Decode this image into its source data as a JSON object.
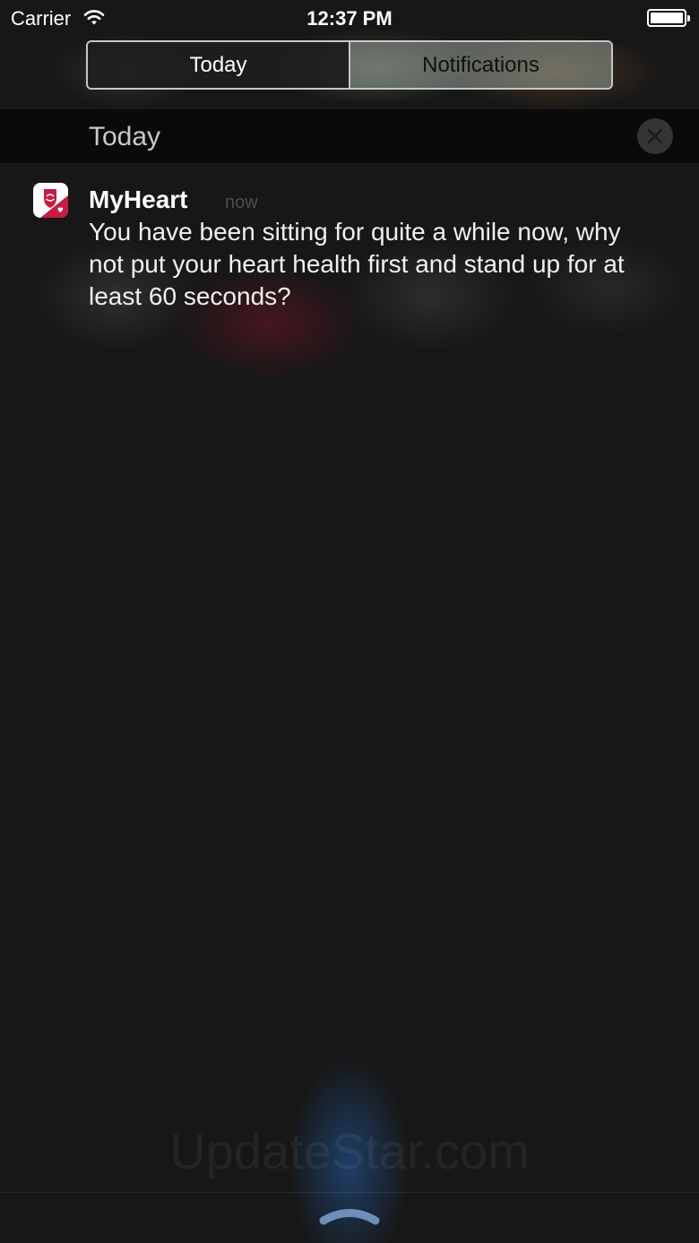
{
  "status_bar": {
    "carrier": "Carrier",
    "time": "12:37 PM",
    "icons": [
      "wifi-icon",
      "battery-icon"
    ]
  },
  "tabs": {
    "items": [
      {
        "label": "Today",
        "selected": true
      },
      {
        "label": "Notifications",
        "selected": false
      }
    ]
  },
  "section": {
    "title": "Today",
    "clear_icon": "close-icon"
  },
  "notification": {
    "app_name": "MyHeart",
    "timestamp": "now",
    "message": "You have been sitting for quite a while now, why not put your heart health first and stand up for at least 60 seconds?",
    "app_icon": "myheart-app-icon"
  },
  "watermark": "UpdateStar.com",
  "bottom_bar": {
    "grabber_icon": "chevron-up-icon"
  },
  "colors": {
    "background": "#171717",
    "app_icon_red": "#c41e45",
    "segment_unselected_bg": "#8f958e",
    "siri_glow": "#2f6fc9"
  }
}
